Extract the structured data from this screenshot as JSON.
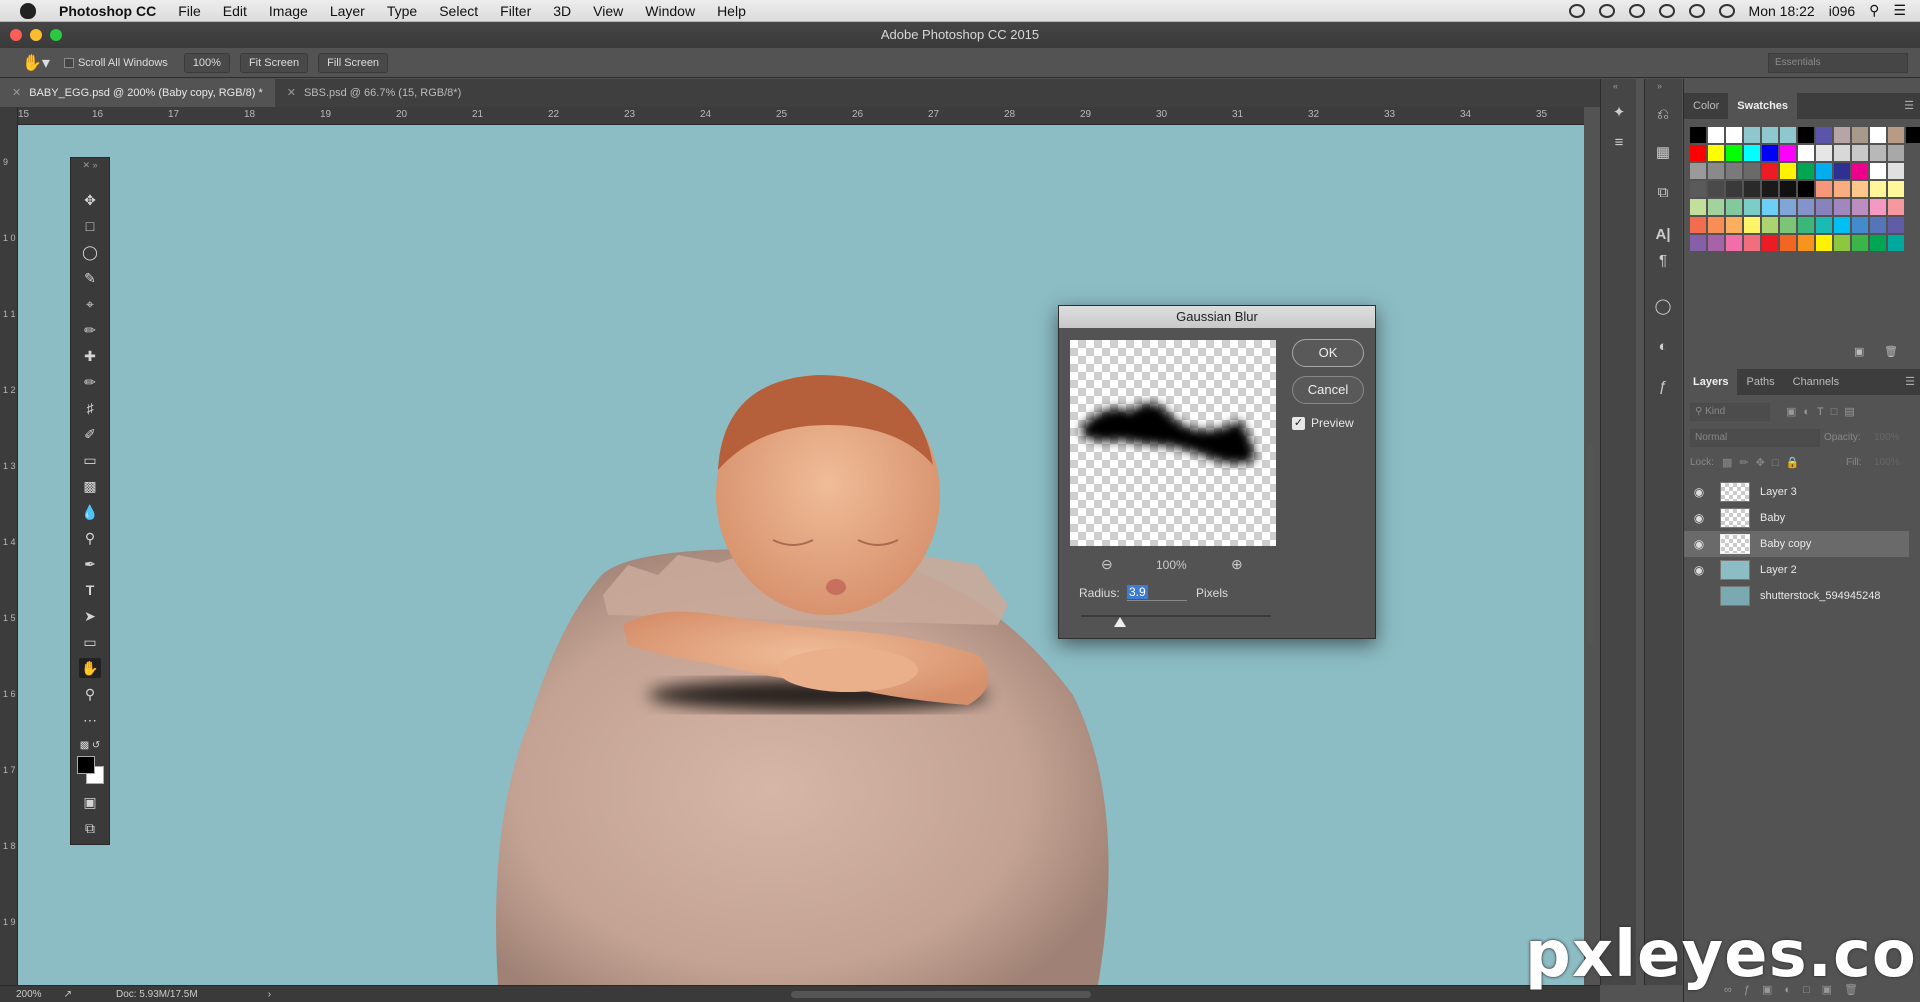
{
  "menubar": {
    "app_name": "Photoshop CC",
    "items": [
      "File",
      "Edit",
      "Image",
      "Layer",
      "Type",
      "Select",
      "Filter",
      "3D",
      "View",
      "Window",
      "Help"
    ],
    "clock": "Mon 18:22",
    "user": "i096"
  },
  "window": {
    "title": "Adobe Photoshop CC 2015"
  },
  "options": {
    "scroll_all": "Scroll All Windows",
    "zoom_btn": "100%",
    "fit_screen": "Fit Screen",
    "fill_screen": "Fill Screen",
    "workspace": "Essentials"
  },
  "tabs": [
    {
      "label": "BABY_EGG.psd @ 200% (Baby copy, RGB/8) *",
      "active": true
    },
    {
      "label": "SBS.psd @ 66.7% (15, RGB/8*)",
      "active": false
    }
  ],
  "ruler": {
    "h_ticks": [
      "15",
      "16",
      "17",
      "18",
      "19",
      "20",
      "21",
      "22",
      "23",
      "24",
      "25",
      "26",
      "27",
      "28",
      "29",
      "30",
      "31",
      "32",
      "33",
      "34",
      "35"
    ],
    "v_ticks": [
      "9",
      "1 0",
      "1 1",
      "1 2",
      "1 3",
      "1 4",
      "1 5",
      "1 6",
      "1 7",
      "1 8",
      "1 9"
    ]
  },
  "dialog": {
    "title": "Gaussian Blur",
    "ok": "OK",
    "cancel": "Cancel",
    "preview_label": "Preview",
    "preview_checked": true,
    "zoom": "100%",
    "radius_label": "Radius:",
    "radius_value": "3.9",
    "radius_unit": "Pixels"
  },
  "swatch_panel": {
    "tabs": [
      "Color",
      "Swatches"
    ],
    "active_tab": "Swatches",
    "rows": [
      [
        "#000000",
        "#ffffff",
        "#ffffff",
        "#8fc7cf",
        "#8fc7cf",
        "#8fc7cf",
        "#000000",
        "#5a55a8",
        "#b7a4a4",
        "#a89a8a",
        "#ffffff",
        "#b99a86",
        "#000000"
      ],
      [
        "#ff0000",
        "#ffff00",
        "#00ff00",
        "#00ffff",
        "#0000ff",
        "#ff00ff",
        "#ffffff",
        "#e6e6e6",
        "#d8d8d8",
        "#c8c8c8",
        "#b8b8b8",
        "#a8a8a8"
      ],
      [
        "#9a9a9a",
        "#8a8a8a",
        "#7a7a7a",
        "#6a6a6a",
        "#ed1c24",
        "#fff200",
        "#00a651",
        "#00aeef",
        "#2e3192",
        "#ec008c",
        "#ffffff",
        "#e0e0e0"
      ],
      [
        "#5a5a5a",
        "#4a4a4a",
        "#3a3a3a",
        "#2a2a2a",
        "#1a1a1a",
        "#111111",
        "#000000",
        "#f7977a",
        "#f9ad81",
        "#fdc68a",
        "#fff79a",
        "#fff79a"
      ],
      [
        "#c4df9b",
        "#a3d39c",
        "#82ca9d",
        "#7bcdc8",
        "#6ecff6",
        "#7ea7d8",
        "#8493ca",
        "#8882be",
        "#a187be",
        "#bc8dbf",
        "#f49ac2",
        "#f6989d"
      ],
      [
        "#f26c4f",
        "#f68e55",
        "#fbaf5c",
        "#fff467",
        "#acd372",
        "#7cc576",
        "#3bb878",
        "#1abbb4",
        "#00bff3",
        "#438ccb",
        "#5574b9",
        "#605ca8"
      ],
      [
        "#855fa8",
        "#a763a8",
        "#f06eaa",
        "#f26d7d",
        "#ed1c24",
        "#f26522",
        "#f7941d",
        "#fff200",
        "#8dc73f",
        "#39b54a",
        "#00a651",
        "#00a99d"
      ]
    ]
  },
  "layers_panel": {
    "tabs": [
      "Layers",
      "Paths",
      "Channels"
    ],
    "active_tab": "Layers",
    "kind_placeholder": "Kind",
    "blend_mode": "Normal",
    "opacity_label": "Opacity:",
    "opacity_value": "100%",
    "lock_label": "Lock:",
    "fill_label": "Fill:",
    "fill_value": "100%",
    "layers": [
      {
        "name": "Layer 3",
        "visible": true,
        "selected": false
      },
      {
        "name": "Baby",
        "visible": true,
        "selected": false
      },
      {
        "name": "Baby copy",
        "visible": true,
        "selected": true
      },
      {
        "name": "Layer 2",
        "visible": true,
        "selected": false
      },
      {
        "name": "shutterstock_594945248",
        "visible": false,
        "selected": false
      }
    ]
  },
  "status": {
    "zoom": "200%",
    "doc": "Doc: 5.93M/17.5M"
  },
  "watermark": "pxleyes.com",
  "colors": {
    "canvas_bg": "#8cbcc4",
    "egg": "#c9a999",
    "accent_selection": "#3d7bd4"
  }
}
